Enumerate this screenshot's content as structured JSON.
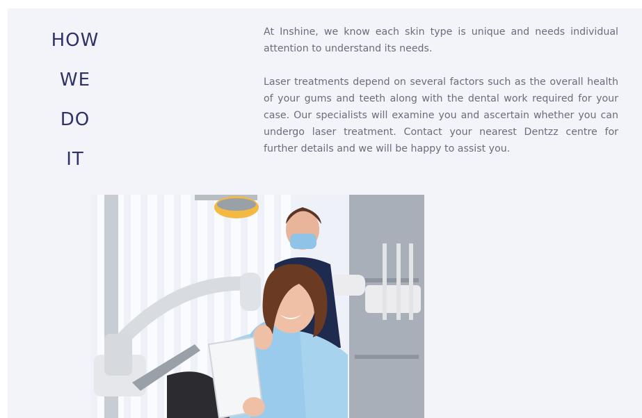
{
  "section": {
    "heading_words": [
      "HOW",
      "WE",
      "DO",
      "IT"
    ],
    "paragraphs": [
      "At Inshine, we know each skin type is unique and needs individual attention to understand its needs.",
      "Laser treatments depend on several factors such as the overall health of your gums and teeth along with the dental work required for your case. Our specialists will examine you and ascertain whether you can undergo laser treatment. Contact your nearest Dentzz centre for further details and we will be happy to assist you."
    ]
  },
  "photo": {
    "subject": "dental-clinic-patient-with-mirror-photo"
  },
  "colors": {
    "background": "#f3f4f9",
    "heading": "#2e3266",
    "body_text": "#6b6b7e"
  }
}
